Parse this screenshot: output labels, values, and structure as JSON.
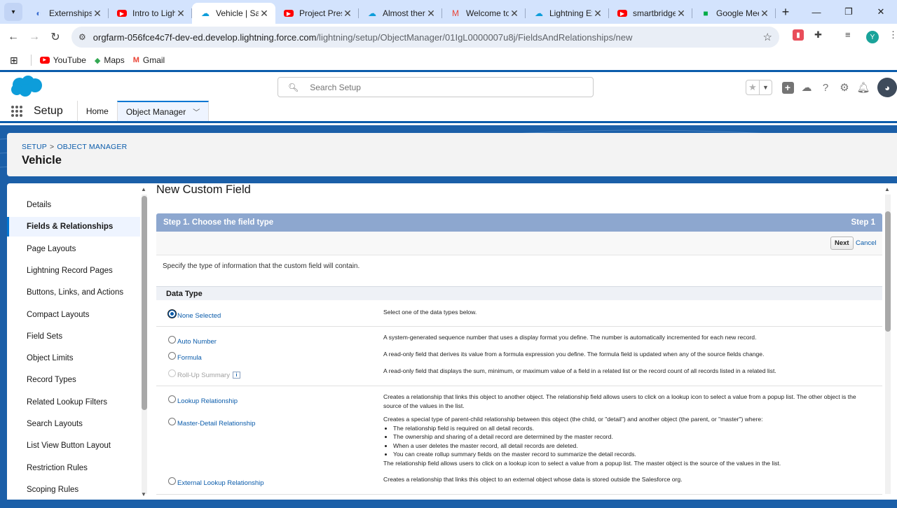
{
  "browser": {
    "tabs": [
      {
        "title": "Externships |",
        "icon": "tab-page-icon",
        "color": "#3c6fd1"
      },
      {
        "title": "Intro to Lightn",
        "icon": "youtube-icon",
        "color": "#ff0000"
      },
      {
        "title": "Vehicle | Sales",
        "icon": "salesforce-cloud-icon",
        "color": "#0d9dda",
        "active": true
      },
      {
        "title": "Project Presen",
        "icon": "youtube-icon",
        "color": "#ff0000"
      },
      {
        "title": "Almost there!",
        "icon": "salesforce-cloud-icon",
        "color": "#0d9dda"
      },
      {
        "title": "Welcome to S",
        "icon": "gmail-icon",
        "color": "#ea4335"
      },
      {
        "title": "Lightning Exp",
        "icon": "salesforce-cloud-icon",
        "color": "#0d9dda"
      },
      {
        "title": "smartbridge_",
        "icon": "youtube-icon",
        "color": "#ff0000"
      },
      {
        "title": "Google Meet",
        "icon": "google-meet-icon",
        "color": "#00ac47"
      }
    ],
    "url_host": "orgfarm-056fce4c7f-dev-ed.develop.lightning.force.com",
    "url_path": "/lightning/setup/ObjectManager/01IgL0000007u8j/FieldsAndRelationships/new",
    "profile_initial": "Y",
    "bookmarks": [
      {
        "label": "YouTube",
        "icon": "youtube-icon"
      },
      {
        "label": "Maps",
        "icon": "maps-icon"
      },
      {
        "label": "Gmail",
        "icon": "gmail-icon"
      }
    ]
  },
  "sf": {
    "search_placeholder": "Search Setup",
    "app_name": "Setup",
    "nav": {
      "home": "Home",
      "object_manager": "Object Manager"
    },
    "breadcrumb": {
      "setup": "SETUP",
      "sep": ">",
      "object_manager": "OBJECT MANAGER"
    },
    "object_title": "Vehicle"
  },
  "sidebar": {
    "items": [
      "Details",
      "Fields & Relationships",
      "Page Layouts",
      "Lightning Record Pages",
      "Buttons, Links, and Actions",
      "Compact Layouts",
      "Field Sets",
      "Object Limits",
      "Record Types",
      "Related Lookup Filters",
      "Search Layouts",
      "List View Button Layout",
      "Restriction Rules",
      "Scoping Rules"
    ],
    "active_index": 1
  },
  "form": {
    "heading": "New Custom Field",
    "step_title": "Step 1. Choose the field type",
    "step_label": "Step 1",
    "next": "Next",
    "cancel": "Cancel",
    "specify": "Specify the type of information that the custom field will contain.",
    "data_type_header": "Data Type",
    "options": {
      "none": {
        "label": "None Selected",
        "desc": "Select one of the data types below."
      },
      "auto": {
        "label": "Auto Number",
        "desc": "A system-generated sequence number that uses a display format you define. The number is automatically incremented for each new record."
      },
      "formula": {
        "label": "Formula",
        "desc": "A read-only field that derives its value from a formula expression you define. The formula field is updated when any of the source fields change."
      },
      "rollup": {
        "label": "Roll-Up Summary",
        "info": "i",
        "desc": "A read-only field that displays the sum, minimum, or maximum value of a field in a related list or the record count of all records listed in a related list."
      },
      "lookup": {
        "label": "Lookup Relationship",
        "desc": "Creates a relationship that links this object to another object. The relationship field allows users to click on a lookup icon to select a value from a popup list. The other object is the source of the values in the list."
      },
      "master": {
        "label": "Master-Detail Relationship",
        "desc": "Creates a special type of parent-child relationship between this object (the child, or \"detail\") and another object (the parent, or \"master\") where:",
        "bullets": [
          "The relationship field is required on all detail records.",
          "The ownership and sharing of a detail record are determined by the master record.",
          "When a user deletes the master record, all detail records are deleted.",
          "You can create rollup summary fields on the master record to summarize the detail records."
        ],
        "desc2": "The relationship field allows users to click on a lookup icon to select a value from a popup list. The master object is the source of the values in the list."
      },
      "external": {
        "label": "External Lookup Relationship",
        "desc": "Creates a relationship that links this object to an external object whose data is stored outside the Salesforce org."
      }
    },
    "selected": "none"
  },
  "colors": {
    "brand": "#0b5cab",
    "header_band": "#1b5fa8",
    "step_bar": "#8da7cf"
  }
}
